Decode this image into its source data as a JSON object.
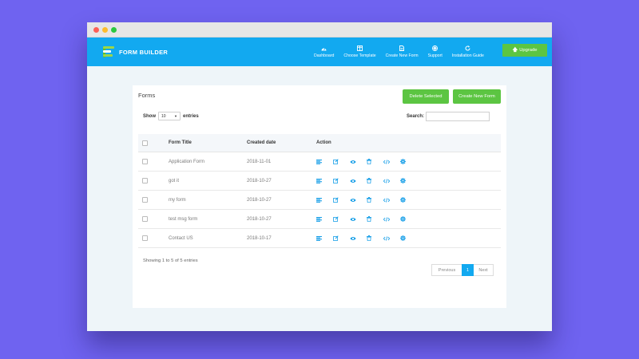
{
  "brand": {
    "name": "FORM BUILDER"
  },
  "nav": [
    {
      "label": "Dashboard",
      "icon": "dashboard-icon"
    },
    {
      "label": "Choose Template",
      "icon": "template-icon"
    },
    {
      "label": "Create New Form",
      "icon": "file-icon"
    },
    {
      "label": "Support",
      "icon": "lifebuoy-icon"
    },
    {
      "label": "Installation Guide",
      "icon": "refresh-icon"
    }
  ],
  "upgrade_label": "Upgrade",
  "panel": {
    "title": "Forms",
    "delete_label": "Delete Selected",
    "create_label": "Create New Form"
  },
  "length": {
    "show": "Show",
    "value": "10",
    "entries": "entries"
  },
  "search": {
    "label": "Search:",
    "value": ""
  },
  "table": {
    "headers": {
      "title": "Form Title",
      "date": "Created date",
      "action": "Action"
    },
    "rows": [
      {
        "title": "Application Form",
        "date": "2018-11-01"
      },
      {
        "title": "got it",
        "date": "2018-10-27"
      },
      {
        "title": "my form",
        "date": "2018-10-27"
      },
      {
        "title": "test msg form",
        "date": "2018-10-27"
      },
      {
        "title": "Contact US",
        "date": "2018-10-17"
      }
    ]
  },
  "info": "Showing 1 to 5 of 5 entries",
  "pagination": {
    "prev": "Previous",
    "current": "1",
    "next": "Next"
  },
  "colors": {
    "nav": "#12a9f0",
    "accent_green": "#5cc542",
    "background": "#6f63f0",
    "icon": "#1aa0e8"
  }
}
